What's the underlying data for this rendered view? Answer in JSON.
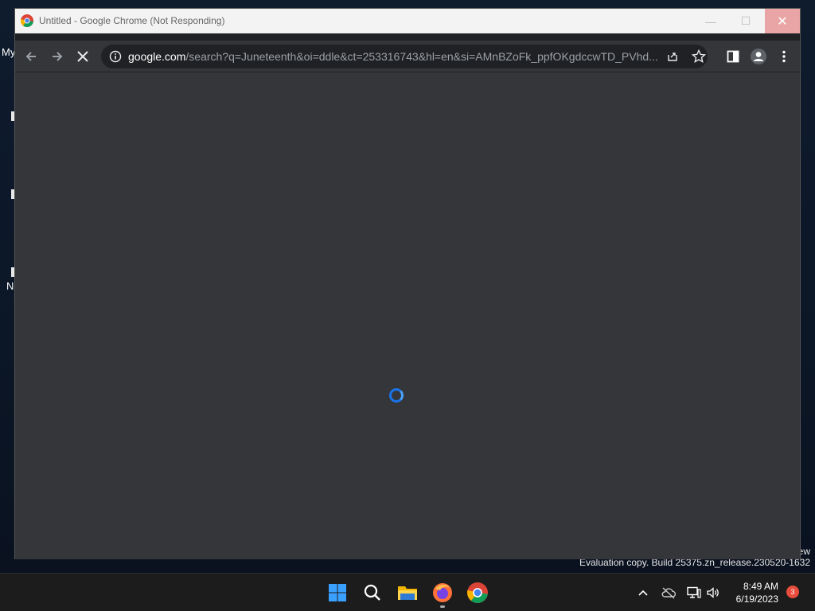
{
  "desktop": {
    "labels": [
      "My",
      "N"
    ],
    "watermark_tail": "ew",
    "watermark": "Evaluation copy. Build 25375.zn_release.230520-1632"
  },
  "window": {
    "title": "Untitled - Google Chrome (Not Responding)",
    "controls": {
      "minimize": "—",
      "maximize": "☐",
      "close": "✕"
    }
  },
  "toolbar": {
    "url_host": "google.com",
    "url_path": "/search?q=Juneteenth&oi=ddle&ct=253316743&hl=en&si=AMnBZoFk_ppfOKgdccwTD_PVhd..."
  },
  "taskbar": {
    "apps": [
      "start",
      "search",
      "file-explorer",
      "firefox",
      "chrome"
    ],
    "clock": {
      "time": "8:49 AM",
      "date": "6/19/2023"
    },
    "notification_count": "3"
  },
  "colors": {
    "accent": "#1a73e8",
    "chrome_bg": "#35363a",
    "close_button": "#e9a5a5",
    "badge": "#e74c3c"
  }
}
